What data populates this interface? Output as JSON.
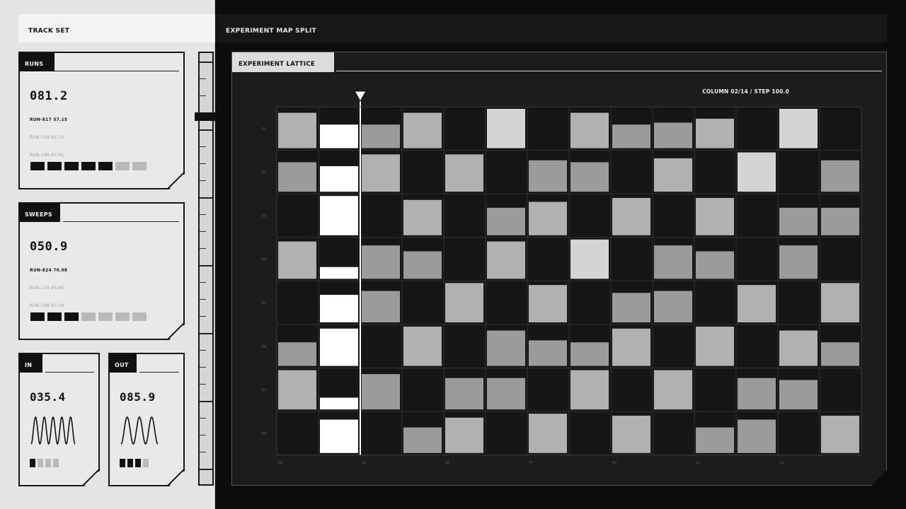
{
  "left_header": {
    "title": "TRACK SET"
  },
  "right_header": {
    "title": "EXPERIMENT MAP SPLIT"
  },
  "cards": {
    "runs": {
      "label": "RUNS",
      "value": "081.2",
      "rows": [
        {
          "text": "RUN-817  57.15",
          "style": "primary"
        },
        {
          "text": "RUN-518  92.70",
          "style": "dim"
        },
        {
          "text": "RUN-189  87.01",
          "style": "dim"
        }
      ],
      "cells_filled": 5,
      "cells_total": 7
    },
    "sweeps": {
      "label": "SWEEPS",
      "value": "050.9",
      "rows": [
        {
          "text": "RUN-824  70.98",
          "style": "primary"
        },
        {
          "text": "RUN-119  95.85",
          "style": "dim"
        },
        {
          "text": "RUN-198  83.14",
          "style": "dim"
        }
      ],
      "cells_filled": 3,
      "cells_total": 7
    },
    "in": {
      "label": "IN",
      "value": "035.4",
      "wave_cycles": 5,
      "cells_filled": 1,
      "cells_total": 4
    },
    "out": {
      "label": "OUT",
      "value": "085.9",
      "wave_cycles": 3,
      "cells_filled": 3,
      "cells_total": 4
    }
  },
  "lattice": {
    "title": "EXPERIMENT LATTICE",
    "readout": "COLUMN 02/14 / STEP 100.0",
    "row_labels": [
      "01",
      "02",
      "03",
      "04",
      "05",
      "06",
      "07",
      "08"
    ],
    "column_labels": [
      {
        "column": 0,
        "text": "00"
      },
      {
        "column": 2,
        "text": "02"
      },
      {
        "column": 4,
        "text": "04"
      },
      {
        "column": 6,
        "text": "07"
      },
      {
        "column": 8,
        "text": "09"
      },
      {
        "column": 10,
        "text": "11"
      },
      {
        "column": 12,
        "text": "13"
      }
    ],
    "highlight_column": 1,
    "cursor_position": 2.0,
    "highlight_fill": [
      0.6,
      0.65,
      1.0,
      0.3,
      0.7,
      0.95,
      0.3,
      0.85
    ],
    "cells": [
      [
        2,
        0,
        1,
        2,
        0,
        3,
        0,
        2,
        1,
        1,
        2,
        0,
        3,
        0
      ],
      [
        1,
        0,
        2,
        0,
        2,
        0,
        1,
        1,
        0,
        2,
        0,
        3,
        0,
        1
      ],
      [
        0,
        0,
        0,
        2,
        0,
        1,
        2,
        0,
        2,
        0,
        2,
        0,
        1,
        1
      ],
      [
        2,
        0,
        1,
        1,
        0,
        2,
        0,
        3,
        0,
        1,
        1,
        0,
        1,
        0
      ],
      [
        0,
        0,
        1,
        0,
        2,
        0,
        2,
        0,
        1,
        1,
        0,
        2,
        0,
        2
      ],
      [
        1,
        0,
        0,
        2,
        0,
        1,
        1,
        1,
        2,
        0,
        2,
        0,
        2,
        1
      ],
      [
        2,
        0,
        1,
        0,
        1,
        1,
        0,
        2,
        0,
        2,
        0,
        1,
        1,
        0
      ],
      [
        0,
        0,
        0,
        1,
        2,
        0,
        2,
        0,
        2,
        0,
        1,
        1,
        0,
        2
      ]
    ],
    "cell_sizes": [
      [
        0.9,
        0,
        0.6,
        0.9,
        0,
        1.0,
        0,
        0.9,
        0.6,
        0.65,
        0.75,
        0,
        1.0,
        0
      ],
      [
        0.75,
        0,
        0.95,
        0,
        0.95,
        0,
        0.8,
        0.75,
        0,
        0.85,
        0,
        1.0,
        0,
        0.8
      ],
      [
        0,
        0,
        0,
        0.9,
        0,
        0.7,
        0.85,
        0,
        0.95,
        0,
        0.95,
        0,
        0.7,
        0.7
      ],
      [
        0.95,
        0,
        0.85,
        0.7,
        0,
        0.95,
        0,
        1.0,
        0,
        0.85,
        0.7,
        0,
        0.85,
        0
      ],
      [
        0,
        0,
        0.8,
        0,
        1.0,
        0,
        0.95,
        0,
        0.75,
        0.8,
        0,
        0.95,
        0,
        1.0
      ],
      [
        0.6,
        0,
        0,
        1.0,
        0,
        0.9,
        0.65,
        0.6,
        0.95,
        0,
        1.0,
        0,
        0.9,
        0.6
      ],
      [
        1.0,
        0,
        0.9,
        0,
        0.8,
        0.8,
        0,
        1.0,
        0,
        1.0,
        0,
        0.8,
        0.75,
        0
      ],
      [
        0,
        0,
        0,
        0.65,
        0.9,
        0,
        1.0,
        0,
        0.95,
        0,
        0.65,
        0.85,
        0,
        0.95
      ]
    ],
    "colors": {
      "empty": "#141514",
      "light": "#c8c9c7",
      "mid": "#b1b2b0",
      "dark": "#9b9c9a",
      "bright": "#d4d5d3",
      "highlight": "#ffffff",
      "grid": "#2f302f"
    }
  },
  "wave_cards_colors": {
    "filled": "#111111",
    "empty": "#b9b9b7"
  }
}
